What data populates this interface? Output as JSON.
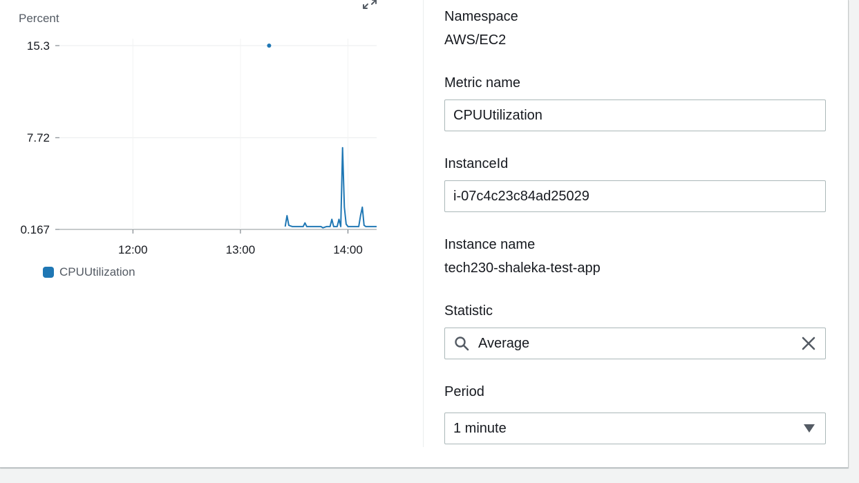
{
  "chart_data": {
    "type": "line",
    "ylabel": "Percent",
    "y_ticks": [
      "15.3",
      "7.72",
      "0.167"
    ],
    "x_ticks": [
      "12:00",
      "13:00",
      "14:00"
    ],
    "ylim": [
      0.167,
      15.3
    ],
    "series": [
      {
        "name": "CPUUtilization",
        "color": "#1f77b4",
        "points": [
          {
            "t": "13:16",
            "v": 15.3
          },
          {
            "t": "13:25",
            "v": 0.4
          },
          {
            "t": "13:26",
            "v": 1.3
          },
          {
            "t": "13:27",
            "v": 0.5
          },
          {
            "t": "13:29",
            "v": 0.4
          },
          {
            "t": "13:33",
            "v": 0.4
          },
          {
            "t": "13:35",
            "v": 0.4
          },
          {
            "t": "13:36",
            "v": 0.7
          },
          {
            "t": "13:37",
            "v": 0.4
          },
          {
            "t": "13:45",
            "v": 0.4
          },
          {
            "t": "13:46",
            "v": 0.3
          },
          {
            "t": "13:48",
            "v": 0.4
          },
          {
            "t": "13:50",
            "v": 0.4
          },
          {
            "t": "13:51",
            "v": 1.0
          },
          {
            "t": "13:52",
            "v": 0.4
          },
          {
            "t": "13:54",
            "v": 0.4
          },
          {
            "t": "13:55",
            "v": 1.0
          },
          {
            "t": "13:56",
            "v": 0.4
          },
          {
            "t": "13:57",
            "v": 6.9
          },
          {
            "t": "13:58",
            "v": 2.0
          },
          {
            "t": "13:59",
            "v": 0.6
          },
          {
            "t": "14:00",
            "v": 0.4
          },
          {
            "t": "14:02",
            "v": 0.4
          },
          {
            "t": "14:03",
            "v": 0.4
          },
          {
            "t": "14:06",
            "v": 0.4
          },
          {
            "t": "14:07",
            "v": 1.3
          },
          {
            "t": "14:08",
            "v": 2.0
          },
          {
            "t": "14:09",
            "v": 0.5
          },
          {
            "t": "14:10",
            "v": 0.4
          },
          {
            "t": "14:16",
            "v": 0.4
          }
        ]
      }
    ],
    "grid": true,
    "legend": "bottom-left"
  },
  "form": {
    "namespace_label": "Namespace",
    "namespace_value": "AWS/EC2",
    "metric_name_label": "Metric name",
    "metric_name_value": "CPUUtilization",
    "instance_id_label": "InstanceId",
    "instance_id_value": "i-07c4c23c84ad25029",
    "instance_name_label": "Instance name",
    "instance_name_value": "tech230-shaleka-test-app",
    "statistic_label": "Statistic",
    "statistic_value": "Average",
    "period_label": "Period",
    "period_value": "1 minute"
  },
  "icons": {
    "expand": "expand-icon",
    "search": "search-icon",
    "clear": "close-icon",
    "caret": "caret-down-icon"
  }
}
